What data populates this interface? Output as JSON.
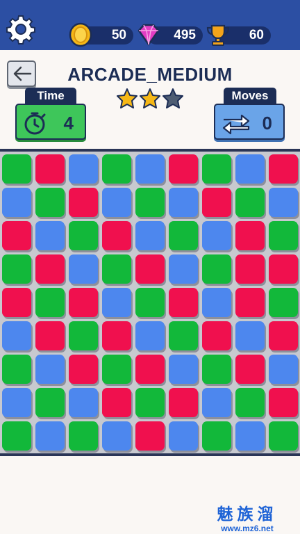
{
  "topbar": {
    "settings_icon": "gear-icon",
    "coins": {
      "icon": "coin-icon",
      "value": "50"
    },
    "gems": {
      "icon": "gem-icon",
      "value": "495"
    },
    "trophies": {
      "icon": "trophy-icon",
      "value": "60"
    }
  },
  "header": {
    "back_icon": "arrow-left-icon",
    "level_title": "ARCADE_MEDIUM",
    "stars": {
      "earned": 2,
      "total": 3
    }
  },
  "stats": {
    "time": {
      "label": "Time",
      "value": "4",
      "icon": "stopwatch-icon"
    },
    "moves": {
      "label": "Moves",
      "value": "0",
      "icon": "swap-arrows-icon"
    }
  },
  "board": {
    "colors": {
      "g": "#12b83a",
      "r": "#f0104e",
      "b": "#4d87ee"
    },
    "rows": [
      [
        "g",
        "r",
        "b",
        "g",
        "b",
        "r",
        "g",
        "b",
        "r"
      ],
      [
        "b",
        "g",
        "r",
        "b",
        "g",
        "b",
        "r",
        "g",
        "b"
      ],
      [
        "r",
        "b",
        "g",
        "r",
        "b",
        "g",
        "b",
        "r",
        "g"
      ],
      [
        "g",
        "r",
        "b",
        "g",
        "r",
        "b",
        "g",
        "r",
        "r"
      ],
      [
        "r",
        "g",
        "r",
        "b",
        "g",
        "r",
        "b",
        "r",
        "g"
      ],
      [
        "b",
        "r",
        "g",
        "r",
        "b",
        "g",
        "r",
        "b",
        "r"
      ],
      [
        "g",
        "b",
        "r",
        "g",
        "r",
        "b",
        "g",
        "r",
        "b"
      ],
      [
        "b",
        "g",
        "b",
        "r",
        "g",
        "r",
        "b",
        "g",
        "r"
      ],
      [
        "g",
        "b",
        "g",
        "b",
        "r",
        "b",
        "g",
        "b",
        "g"
      ]
    ]
  },
  "watermark": {
    "chinese": "魅族溜",
    "url": "www.mz6.net"
  }
}
